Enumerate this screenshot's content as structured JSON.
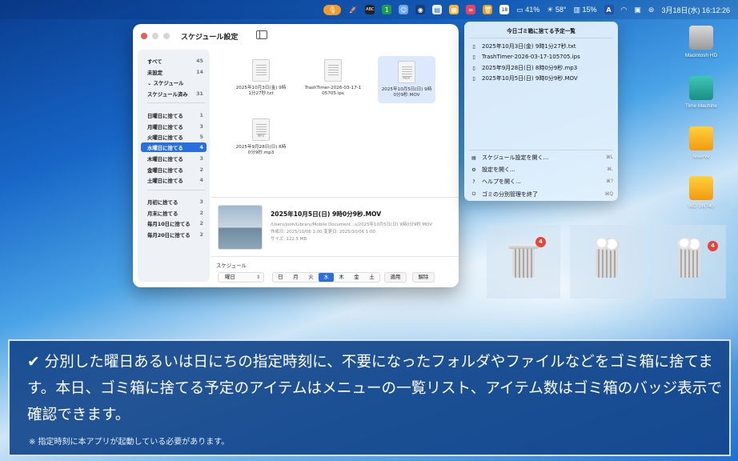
{
  "menubar": {
    "battery_pct": "41%",
    "temperature": "58°",
    "cpu_pct": "15%",
    "date_time": "3月18日(水)  16:12:26",
    "icons": [
      "microphone-icon",
      "rocket-icon",
      "app-icon",
      "one-icon",
      "finder-icon",
      "chart-icon",
      "folder-icon",
      "table-icon",
      "link-icon",
      "trash-icon",
      "calendar-icon",
      "keyboard-icon",
      "battery-icon",
      "a-icon",
      "wifi-icon",
      "display-icon",
      "control-center-icon"
    ],
    "calendar_day": "18",
    "keyboard_letter": "A",
    "app_letters": "ABC",
    "one_label": "1"
  },
  "window": {
    "title": "スケジュール設定",
    "sidebar": [
      {
        "label": "すべて",
        "count": "45"
      },
      {
        "label": "未設定",
        "count": "14"
      },
      {
        "label": "スケジュール",
        "count": ""
      },
      {
        "label": "スケジュール済み",
        "count": "31"
      },
      {
        "label": "日曜日に捨てる",
        "count": "1"
      },
      {
        "label": "月曜日に捨てる",
        "count": "3"
      },
      {
        "label": "火曜日に捨てる",
        "count": "5"
      },
      {
        "label": "水曜日に捨てる",
        "count": "4"
      },
      {
        "label": "木曜日に捨てる",
        "count": "3"
      },
      {
        "label": "金曜日に捨てる",
        "count": "2"
      },
      {
        "label": "土曜日に捨てる",
        "count": "4"
      },
      {
        "label": "月初に捨てる",
        "count": "3"
      },
      {
        "label": "月末に捨てる",
        "count": "2"
      },
      {
        "label": "毎月10日に捨てる",
        "count": "2"
      },
      {
        "label": "毎月20日に捨てる",
        "count": "2"
      }
    ],
    "files": [
      {
        "name1": "2025年10月3日(金) 9時",
        "name2": "1分27秒.txt"
      },
      {
        "name1": "TrashTimer-2026-03-17-1",
        "name2": "05705.ips"
      },
      {
        "name1": "2025年10月5日(日) 9時",
        "name2": "0分9秒.MOV"
      },
      {
        "name1": "2025年9月28日(日) 8時",
        "name2": "0分9秒.mp3"
      }
    ],
    "file_badges": {
      "mov": "MOV",
      "mp3": "MP3"
    },
    "detail": {
      "title": "2025年10月5日(日) 9時0分9秒.MOV",
      "path": "/Users/jooh/Library/Mobile Document...s/2025年10月5日(日) 9時0分9秒.MOV",
      "created": "作成日: 2025/10/06 1:00     変更日: 2025/10/06 1:00",
      "size": "サイズ: 122.5 MB"
    },
    "schedule_label": "スケジュール",
    "schedule_mode": "曜日",
    "weekdays": [
      "日",
      "月",
      "火",
      "水",
      "木",
      "金",
      "土"
    ],
    "selected_weekday": "水",
    "apply_label": "適用",
    "cancel_label": "解除"
  },
  "popup": {
    "title": "今日ゴミ箱に捨てる予定一覧",
    "items": [
      "2025年10月3日(金) 9時1分27秒.txt",
      "TrashTimer-2026-03-17-105705.ips",
      "2025年9月28日(日) 8時0分9秒.mp3",
      "2025年10月5日(日) 9時0分9秒.MOV"
    ],
    "actions": [
      {
        "label": "スケジュール設定を開く...",
        "shortcut": "⌘L"
      },
      {
        "label": "設定を開く...",
        "shortcut": "⌘,"
      },
      {
        "label": "ヘルプを開く...",
        "shortcut": "⌘?"
      },
      {
        "label": "ゴミの分別管理を終了",
        "shortcut": "⌘Q"
      }
    ]
  },
  "desktop": [
    {
      "label": "Macintosh HD"
    },
    {
      "label": "Time Machine"
    },
    {
      "label": "reserve"
    },
    {
      "label": "WD SN740"
    }
  ],
  "trash_badges": [
    "4",
    "4"
  ],
  "caption": {
    "main": "✔ 分別した曜日あるいは日にちの指定時刻に、不要になったフォルダやファイルなどをゴミ箱に捨てます。本日、ゴミ箱に捨てる予定のアイテムはメニューの一覧リスト、アイテム数はゴミ箱のバッジ表示で確認できます。",
    "note": "※ 指定時刻に本アプリが起動している必要があります。"
  },
  "colors": {
    "accent": "#2a6fe0",
    "badge": "#e7443a",
    "caption_bg": "#14468c"
  }
}
